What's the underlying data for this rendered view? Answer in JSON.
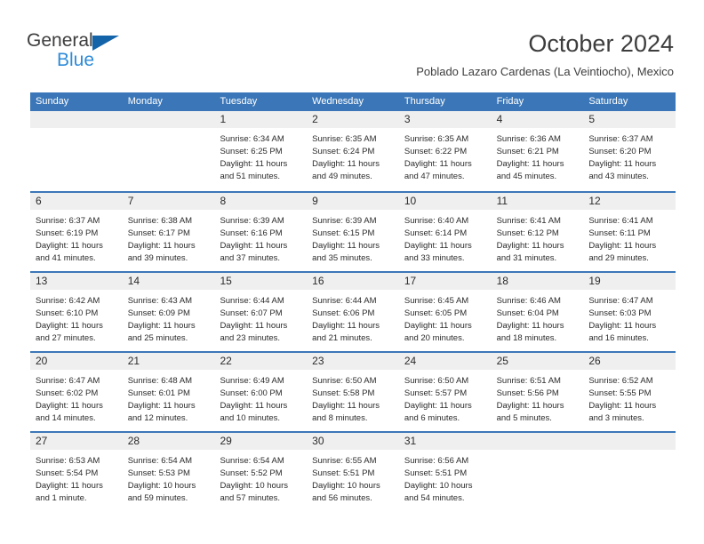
{
  "brand": {
    "name_top": "General",
    "name_bottom": "Blue",
    "triangle_icon": "triangle-icon",
    "colors": {
      "top_text": "#3d3d3d",
      "bottom_text": "#2e8bd8",
      "triangle": "#1464aa"
    }
  },
  "header": {
    "title": "October 2024",
    "subtitle": "Poblado Lazaro Cardenas (La Veintiocho), Mexico"
  },
  "theme": {
    "header_bar": "#3b77b8",
    "day_band": "#efefef",
    "row_separator": "#3b77b8",
    "text": "#2b2b2b"
  },
  "calendar": {
    "weekdays": [
      "Sunday",
      "Monday",
      "Tuesday",
      "Wednesday",
      "Thursday",
      "Friday",
      "Saturday"
    ],
    "weeks": [
      [
        {
          "day": "",
          "lines": []
        },
        {
          "day": "",
          "lines": []
        },
        {
          "day": "1",
          "lines": [
            "Sunrise: 6:34 AM",
            "Sunset: 6:25 PM",
            "Daylight: 11 hours",
            "and 51 minutes."
          ]
        },
        {
          "day": "2",
          "lines": [
            "Sunrise: 6:35 AM",
            "Sunset: 6:24 PM",
            "Daylight: 11 hours",
            "and 49 minutes."
          ]
        },
        {
          "day": "3",
          "lines": [
            "Sunrise: 6:35 AM",
            "Sunset: 6:22 PM",
            "Daylight: 11 hours",
            "and 47 minutes."
          ]
        },
        {
          "day": "4",
          "lines": [
            "Sunrise: 6:36 AM",
            "Sunset: 6:21 PM",
            "Daylight: 11 hours",
            "and 45 minutes."
          ]
        },
        {
          "day": "5",
          "lines": [
            "Sunrise: 6:37 AM",
            "Sunset: 6:20 PM",
            "Daylight: 11 hours",
            "and 43 minutes."
          ]
        }
      ],
      [
        {
          "day": "6",
          "lines": [
            "Sunrise: 6:37 AM",
            "Sunset: 6:19 PM",
            "Daylight: 11 hours",
            "and 41 minutes."
          ]
        },
        {
          "day": "7",
          "lines": [
            "Sunrise: 6:38 AM",
            "Sunset: 6:17 PM",
            "Daylight: 11 hours",
            "and 39 minutes."
          ]
        },
        {
          "day": "8",
          "lines": [
            "Sunrise: 6:39 AM",
            "Sunset: 6:16 PM",
            "Daylight: 11 hours",
            "and 37 minutes."
          ]
        },
        {
          "day": "9",
          "lines": [
            "Sunrise: 6:39 AM",
            "Sunset: 6:15 PM",
            "Daylight: 11 hours",
            "and 35 minutes."
          ]
        },
        {
          "day": "10",
          "lines": [
            "Sunrise: 6:40 AM",
            "Sunset: 6:14 PM",
            "Daylight: 11 hours",
            "and 33 minutes."
          ]
        },
        {
          "day": "11",
          "lines": [
            "Sunrise: 6:41 AM",
            "Sunset: 6:12 PM",
            "Daylight: 11 hours",
            "and 31 minutes."
          ]
        },
        {
          "day": "12",
          "lines": [
            "Sunrise: 6:41 AM",
            "Sunset: 6:11 PM",
            "Daylight: 11 hours",
            "and 29 minutes."
          ]
        }
      ],
      [
        {
          "day": "13",
          "lines": [
            "Sunrise: 6:42 AM",
            "Sunset: 6:10 PM",
            "Daylight: 11 hours",
            "and 27 minutes."
          ]
        },
        {
          "day": "14",
          "lines": [
            "Sunrise: 6:43 AM",
            "Sunset: 6:09 PM",
            "Daylight: 11 hours",
            "and 25 minutes."
          ]
        },
        {
          "day": "15",
          "lines": [
            "Sunrise: 6:44 AM",
            "Sunset: 6:07 PM",
            "Daylight: 11 hours",
            "and 23 minutes."
          ]
        },
        {
          "day": "16",
          "lines": [
            "Sunrise: 6:44 AM",
            "Sunset: 6:06 PM",
            "Daylight: 11 hours",
            "and 21 minutes."
          ]
        },
        {
          "day": "17",
          "lines": [
            "Sunrise: 6:45 AM",
            "Sunset: 6:05 PM",
            "Daylight: 11 hours",
            "and 20 minutes."
          ]
        },
        {
          "day": "18",
          "lines": [
            "Sunrise: 6:46 AM",
            "Sunset: 6:04 PM",
            "Daylight: 11 hours",
            "and 18 minutes."
          ]
        },
        {
          "day": "19",
          "lines": [
            "Sunrise: 6:47 AM",
            "Sunset: 6:03 PM",
            "Daylight: 11 hours",
            "and 16 minutes."
          ]
        }
      ],
      [
        {
          "day": "20",
          "lines": [
            "Sunrise: 6:47 AM",
            "Sunset: 6:02 PM",
            "Daylight: 11 hours",
            "and 14 minutes."
          ]
        },
        {
          "day": "21",
          "lines": [
            "Sunrise: 6:48 AM",
            "Sunset: 6:01 PM",
            "Daylight: 11 hours",
            "and 12 minutes."
          ]
        },
        {
          "day": "22",
          "lines": [
            "Sunrise: 6:49 AM",
            "Sunset: 6:00 PM",
            "Daylight: 11 hours",
            "and 10 minutes."
          ]
        },
        {
          "day": "23",
          "lines": [
            "Sunrise: 6:50 AM",
            "Sunset: 5:58 PM",
            "Daylight: 11 hours",
            "and 8 minutes."
          ]
        },
        {
          "day": "24",
          "lines": [
            "Sunrise: 6:50 AM",
            "Sunset: 5:57 PM",
            "Daylight: 11 hours",
            "and 6 minutes."
          ]
        },
        {
          "day": "25",
          "lines": [
            "Sunrise: 6:51 AM",
            "Sunset: 5:56 PM",
            "Daylight: 11 hours",
            "and 5 minutes."
          ]
        },
        {
          "day": "26",
          "lines": [
            "Sunrise: 6:52 AM",
            "Sunset: 5:55 PM",
            "Daylight: 11 hours",
            "and 3 minutes."
          ]
        }
      ],
      [
        {
          "day": "27",
          "lines": [
            "Sunrise: 6:53 AM",
            "Sunset: 5:54 PM",
            "Daylight: 11 hours",
            "and 1 minute."
          ]
        },
        {
          "day": "28",
          "lines": [
            "Sunrise: 6:54 AM",
            "Sunset: 5:53 PM",
            "Daylight: 10 hours",
            "and 59 minutes."
          ]
        },
        {
          "day": "29",
          "lines": [
            "Sunrise: 6:54 AM",
            "Sunset: 5:52 PM",
            "Daylight: 10 hours",
            "and 57 minutes."
          ]
        },
        {
          "day": "30",
          "lines": [
            "Sunrise: 6:55 AM",
            "Sunset: 5:51 PM",
            "Daylight: 10 hours",
            "and 56 minutes."
          ]
        },
        {
          "day": "31",
          "lines": [
            "Sunrise: 6:56 AM",
            "Sunset: 5:51 PM",
            "Daylight: 10 hours",
            "and 54 minutes."
          ]
        },
        {
          "day": "",
          "lines": []
        },
        {
          "day": "",
          "lines": []
        }
      ]
    ]
  }
}
